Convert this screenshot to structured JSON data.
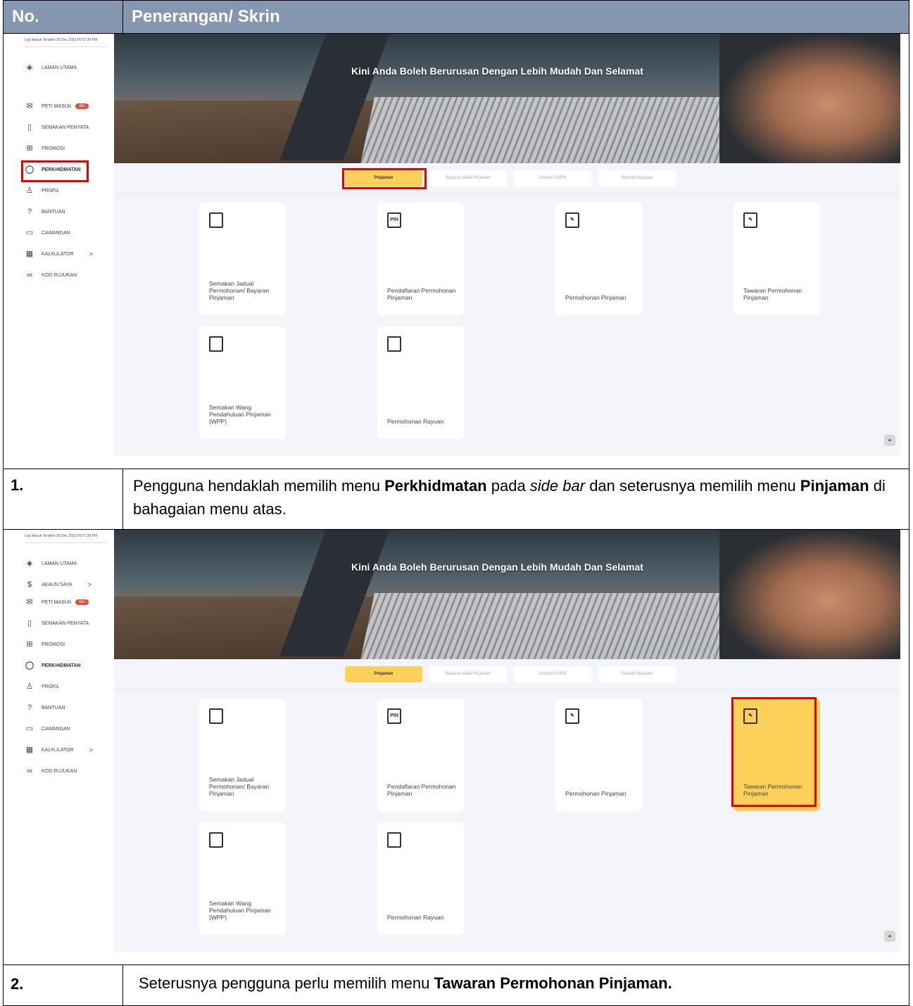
{
  "table": {
    "header_no": "No.",
    "header_desc": "Penerangan/ Skrin"
  },
  "screen": {
    "last_login": "Log Masuk Terakhir 26 Dec 2023 06:57:28 PM",
    "hero_title": "Kini Anda Boleh Berurusan Dengan Lebih Mudah Dan Selamat",
    "sidebar_1": [
      "LAMAN UTAMA",
      "PETI MASUK",
      "SEMAKAN PENYATA",
      "PROMOSI",
      "PERKHIDMATAN",
      "PROFIL",
      "BANTUAN",
      "CAWANGAN",
      "KALKULATOR",
      "KOD RUJUKAN"
    ],
    "sidebar_2": [
      "LAMAN UTAMA",
      "AKAUN SAYA",
      "PETI MASUK",
      "SEMAKAN PENYATA",
      "PROMOSI",
      "PERKHIDMATAN",
      "PROFIL",
      "BANTUAN",
      "CAWANGAN",
      "KALKULATOR",
      "KOD RUJUKAN"
    ],
    "badge": "10+",
    "chevron": ">",
    "tabs": [
      "Pinjaman",
      "Bayaran Balik Pinjaman",
      "Simpan SSPN",
      "Saluran Bayaran"
    ],
    "cards": [
      {
        "label": "Semakan Jadual Permohonan/ Bayaran Pinjaman",
        "icon": "document-search-icon",
        "glyph": ""
      },
      {
        "label": "Pendaftaran Permohonan Pinjaman",
        "icon": "pin-document-icon",
        "glyph": "PIN"
      },
      {
        "label": "Permohonan Pinjaman",
        "icon": "document-sign-icon",
        "glyph": "✎"
      },
      {
        "label": "Tawaran Permohonan Pinjaman",
        "icon": "document-sign-icon",
        "glyph": "✎"
      },
      {
        "label": "Semakan Wang Pendahuluan Pinjaman (WPP)",
        "icon": "document-search-icon",
        "glyph": ""
      },
      {
        "label": "Permohonan Rayuan",
        "icon": "hand-document-icon",
        "glyph": ""
      }
    ],
    "scroll_up": "▲"
  },
  "steps": [
    {
      "no": "1.",
      "text_parts": [
        "Pengguna hendaklah memilih menu ",
        "Perkhidmatan",
        " pada ",
        "side bar",
        " dan seterusnya memilih menu ",
        "Pinjaman",
        " di bahagaian menu atas."
      ]
    },
    {
      "no": "2.",
      "text_parts": [
        "Seterusnya pengguna perlu memilih menu ",
        "Tawaran Permohonan Pinjaman."
      ]
    }
  ],
  "colors": {
    "header_bg": "#8496b0",
    "accent_yellow": "#fdd159",
    "highlight_red": "#e60000",
    "badge_red": "#e4513a"
  }
}
